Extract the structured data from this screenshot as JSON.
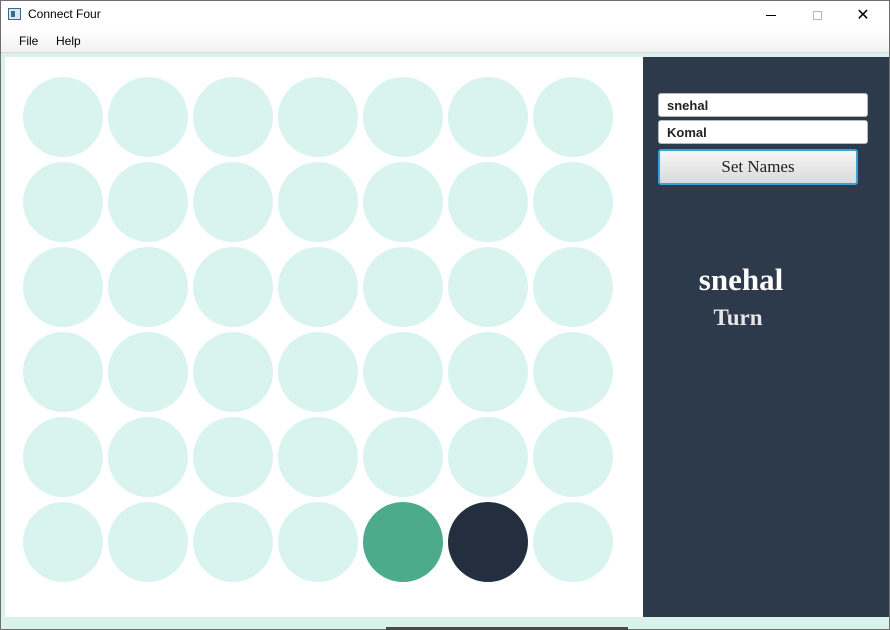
{
  "window": {
    "title": "Connect Four",
    "minimize_icon": "minimize-icon",
    "maximize_icon": "maximize-icon",
    "close_icon": "close-icon",
    "close_glyph": "✕"
  },
  "menu": {
    "items": [
      {
        "label": "File"
      },
      {
        "label": "Help"
      }
    ]
  },
  "board": {
    "rows": 6,
    "columns": 7,
    "empty_color": "#d9f4ef",
    "player1_color": "#4bab8a",
    "player2_color": "#232f3e",
    "cells": [
      [
        "",
        "",
        "",
        "",
        "",
        "",
        ""
      ],
      [
        "",
        "",
        "",
        "",
        "",
        "",
        ""
      ],
      [
        "",
        "",
        "",
        "",
        "",
        "",
        ""
      ],
      [
        "",
        "",
        "",
        "",
        "",
        "",
        ""
      ],
      [
        "",
        "",
        "",
        "",
        "",
        "",
        ""
      ],
      [
        "",
        "",
        "",
        "",
        "p1",
        "p2",
        ""
      ]
    ]
  },
  "panel": {
    "background": "#2c3a4c",
    "player1_value": "snehal",
    "player2_value": "Komal",
    "set_names_label": "Set Names",
    "current_player": "snehal",
    "turn_label": "Turn"
  }
}
